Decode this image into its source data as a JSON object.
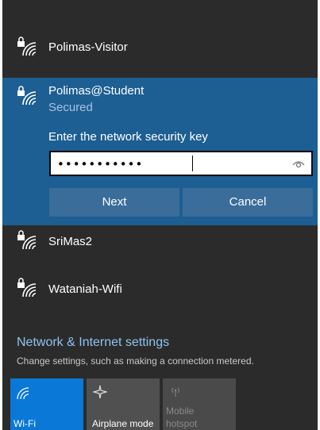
{
  "networks": [
    {
      "name": "Polimas-Visitor"
    },
    {
      "name": "Polimas@Student",
      "status": "Secured"
    },
    {
      "name": "SriMas2"
    },
    {
      "name": "Wataniah-Wifi"
    }
  ],
  "connect_panel": {
    "prompt": "Enter the network security key",
    "key_value": "•••••••••••",
    "next_label": "Next",
    "cancel_label": "Cancel"
  },
  "settings": {
    "title": "Network & Internet settings",
    "subtitle": "Change settings, such as making a connection metered."
  },
  "quick_actions": [
    {
      "label": "Wi-Fi",
      "icon": "wifi-icon",
      "active": true
    },
    {
      "label": "Airplane mode",
      "icon": "airplane-icon",
      "active": false
    },
    {
      "label_line1": "Mobile",
      "label_line2": "hotspot",
      "icon": "hotspot-icon",
      "active": false,
      "disabled": true
    }
  ],
  "colors": {
    "background": "#2b2b2b",
    "selected_panel": "#1d5e93",
    "button": "#3a6d99",
    "accent_tile": "#0a78d7",
    "link": "#8fc3f0"
  }
}
